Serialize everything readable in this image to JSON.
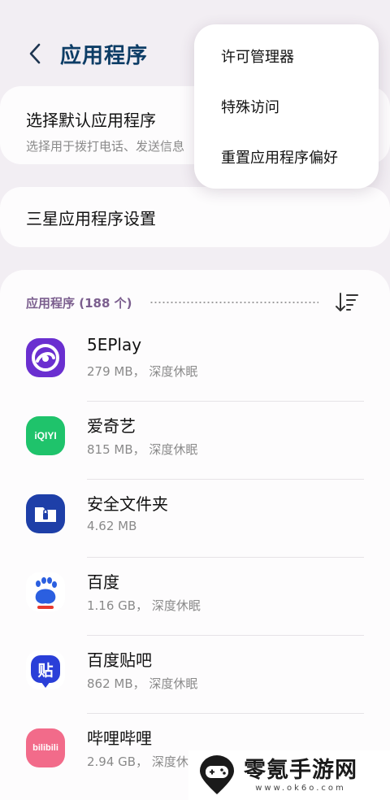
{
  "header": {
    "title": "应用程序",
    "back_icon": "chevron-left-icon"
  },
  "default_apps": {
    "title": "选择默认应用程序",
    "subtitle": "选择用于拨打电话、发送信息"
  },
  "samsung_settings": {
    "title": "三星应用程序设置"
  },
  "apps_section": {
    "count_label": "应用程序 (188 个)",
    "sort_icon": "sort-icon"
  },
  "apps": [
    {
      "name": "5EPlay",
      "meta": "279 MB， 深度休眠",
      "icon": "5eplay-icon",
      "color": "#6a2fd0"
    },
    {
      "name": "爱奇艺",
      "meta": "815 MB， 深度休眠",
      "icon": "iqiyi-icon",
      "color": "#1fc36b",
      "icon_text": "iQIYI"
    },
    {
      "name": "安全文件夹",
      "meta": "4.62 MB",
      "icon": "secure-folder-icon",
      "color": "#1e3fa8"
    },
    {
      "name": "百度",
      "meta": "1.16 GB， 深度休眠",
      "icon": "baidu-icon",
      "color": "#2b5fe0",
      "icon_text": "du"
    },
    {
      "name": "百度贴吧",
      "meta": "862 MB， 深度休眠",
      "icon": "tieba-icon",
      "color": "#2a3fd8",
      "icon_text": "贴"
    },
    {
      "name": "哔哩哔哩",
      "meta": "2.94 GB， 深度休眠",
      "icon": "bilibili-icon",
      "color": "#f26b8a",
      "icon_text": "bilibili"
    }
  ],
  "menu": {
    "items": [
      {
        "label": "许可管理器"
      },
      {
        "label": "特殊访问"
      },
      {
        "label": "重置应用程序偏好"
      }
    ]
  },
  "watermark": {
    "title": "零氪手游网",
    "url": "www.ok6o.com"
  },
  "colors": {
    "title": "#0d3d66",
    "section_label": "#7b5e8e",
    "background": "#f2eef3"
  }
}
